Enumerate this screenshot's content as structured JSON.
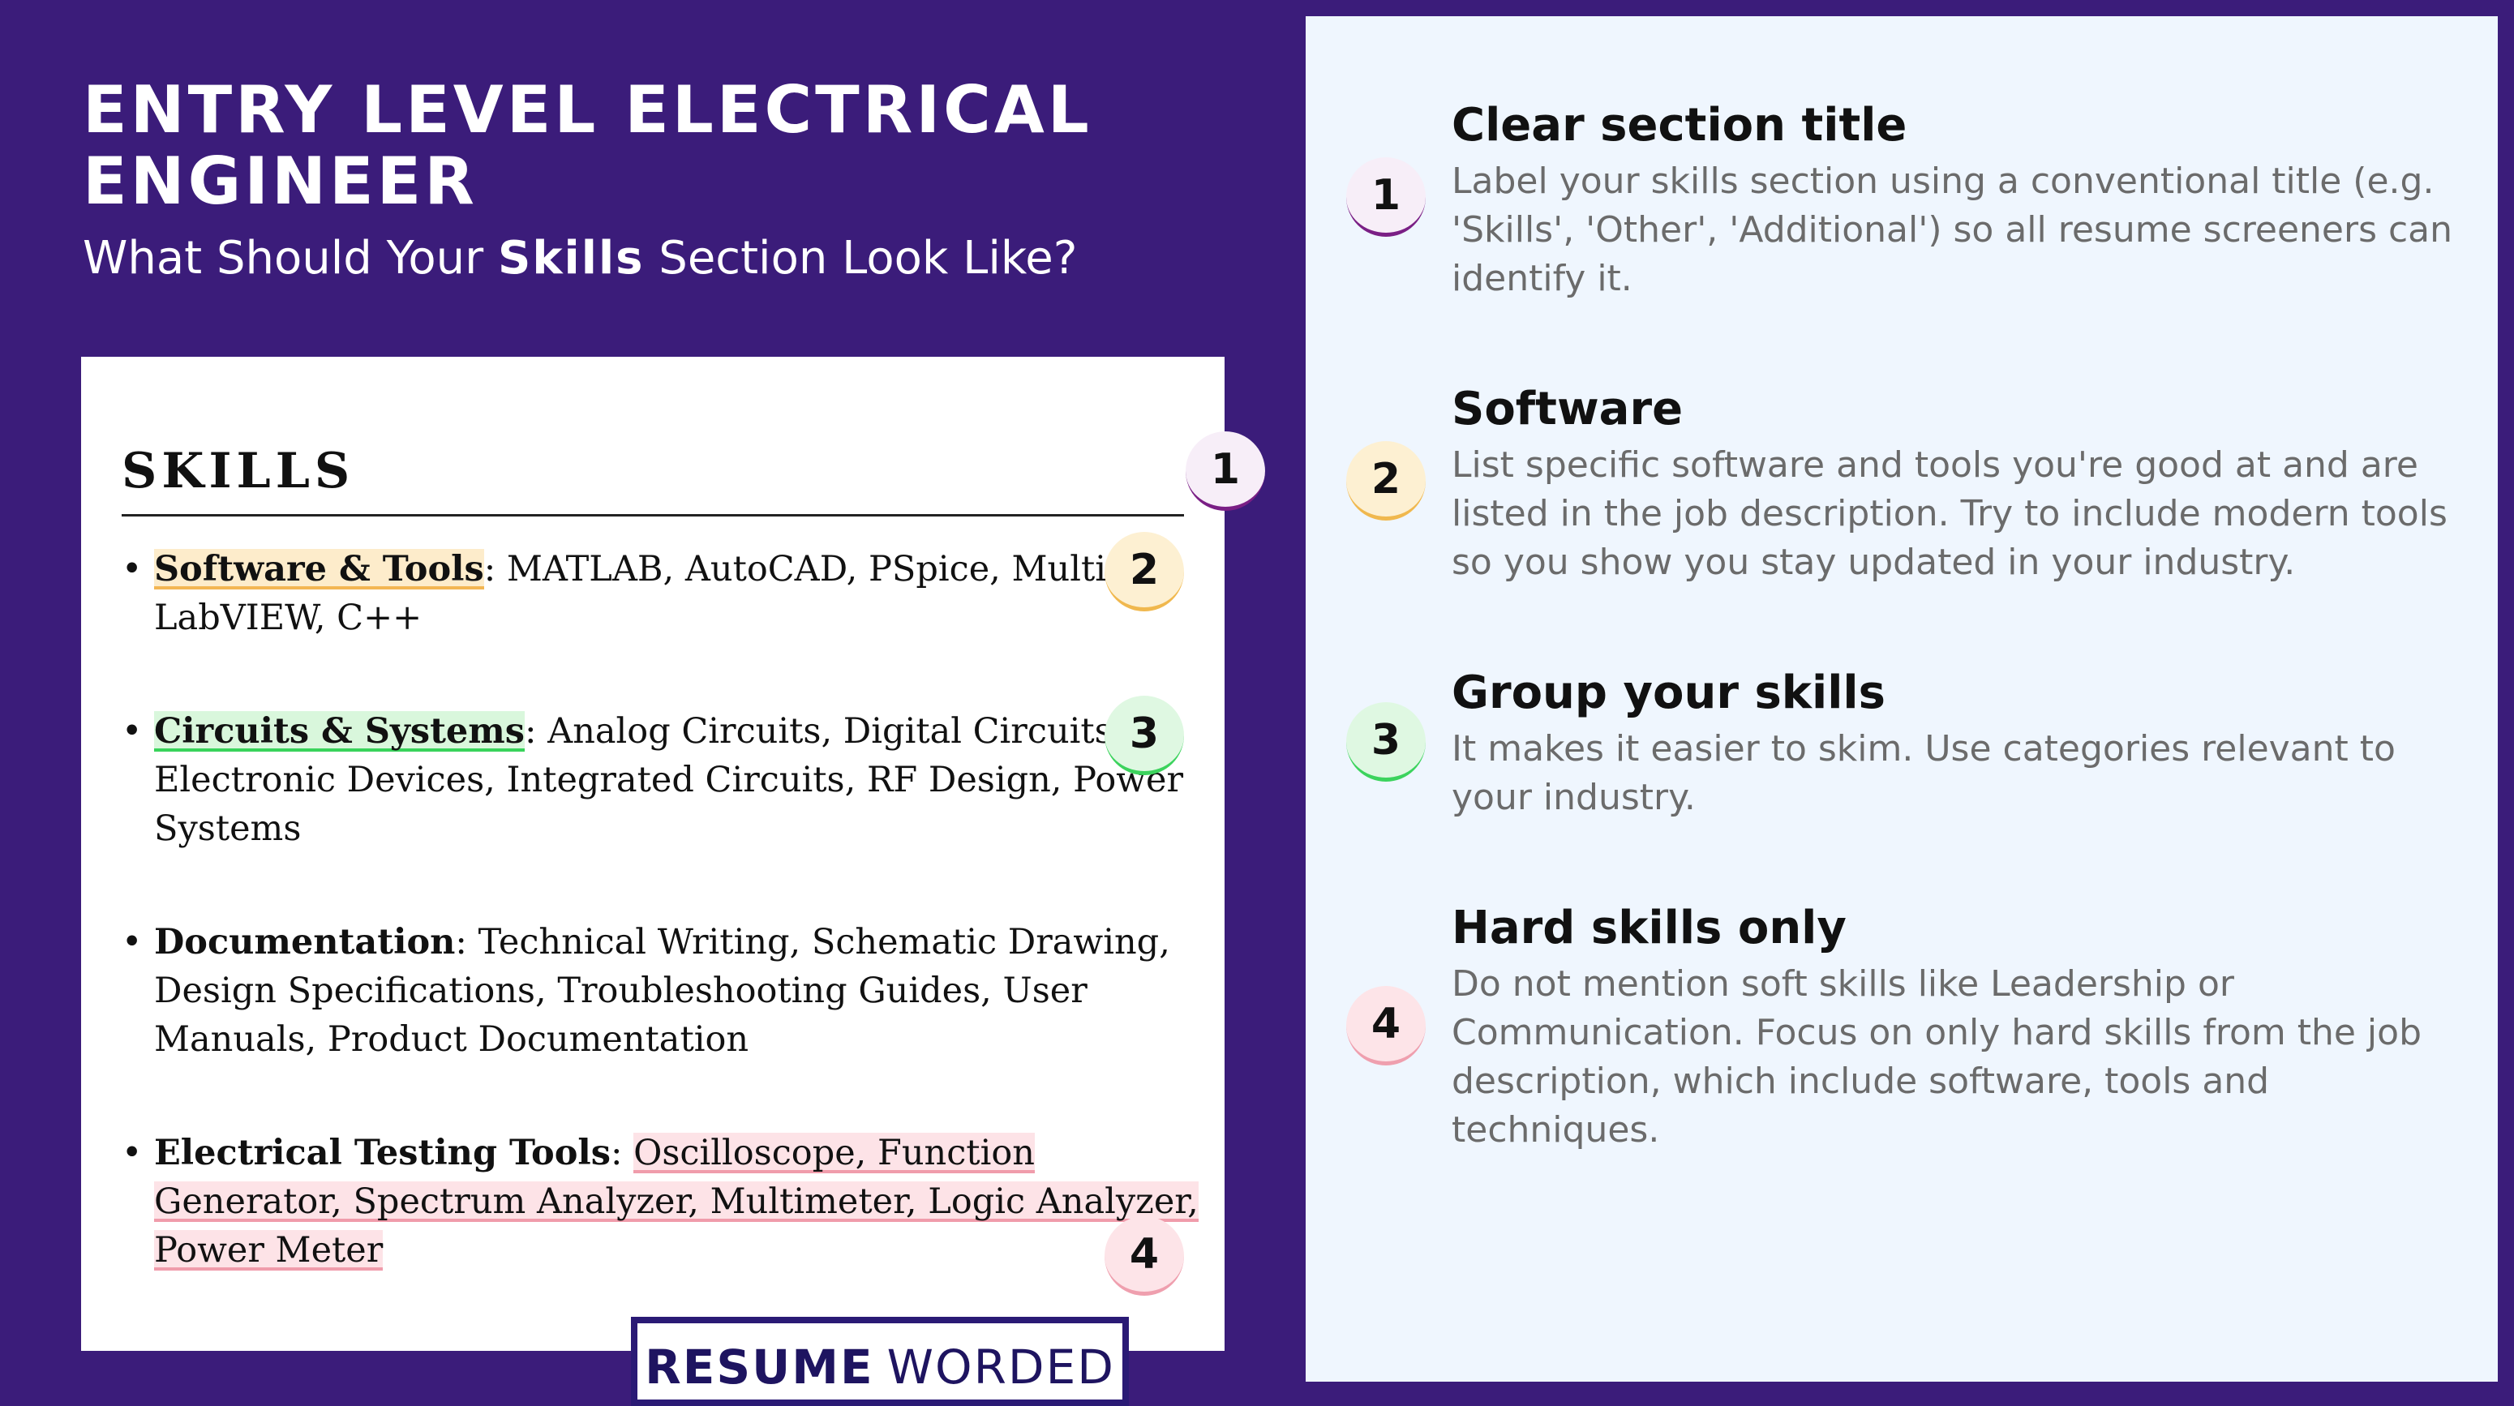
{
  "header": {
    "title": "ENTRY LEVEL ELECTRICAL ENGINEER",
    "subtitle_before": "What Should Your ",
    "subtitle_bold": "Skills",
    "subtitle_after": " Section Look Like?"
  },
  "card": {
    "title": "SKILLS",
    "skills": [
      {
        "category": "Software & Tools",
        "separator": ": ",
        "text": "MATLAB, AutoCAD, PSpice, Multisim, LabVIEW, C++"
      },
      {
        "category": "Circuits & Systems",
        "separator": ": ",
        "text": "Analog Circuits, Digital Circuits, Electronic Devices, Integrated Circuits, RF Design, Power Systems"
      },
      {
        "category": "Documentation",
        "separator": ": ",
        "text": "Technical Writing, Schematic Drawing, Design Specifications, Troubleshooting Guides, User Manuals, Product Documentation"
      },
      {
        "category": "Electrical Testing Tools",
        "separator": ": ",
        "text": "Oscilloscope, Function Generator, Spectrum Analyzer, Multimeter, Logic Analyzer, Power Meter"
      }
    ]
  },
  "badges": [
    "1",
    "2",
    "3",
    "4"
  ],
  "colors": {
    "background": "#3b1c7a",
    "panel": "#eff6fe",
    "badge1": "#7a1f85",
    "badge2": "#f0b84e",
    "badge3": "#3cd35d",
    "badge4": "#ef9fae"
  },
  "tips": [
    {
      "number": "1",
      "title": "Clear section title",
      "text": "Label your skills section using a conventional title (e.g. 'Skills', 'Other', 'Additional') so all resume screeners can identify it."
    },
    {
      "number": "2",
      "title": "Software",
      "text": "List specific software and tools you're good at and are listed in the job description. Try to include modern tools so you show you stay updated in your industry."
    },
    {
      "number": "3",
      "title": "Group your skills",
      "text": "It makes it easier to skim. Use categories relevant to your industry."
    },
    {
      "number": "4",
      "title": "Hard skills only",
      "text": "Do not mention soft skills like Leadership or Communication. Focus on only hard skills from the job description, which include software, tools and techniques."
    }
  ],
  "logo": {
    "bold": "RESUME",
    "light": "WORDED"
  }
}
